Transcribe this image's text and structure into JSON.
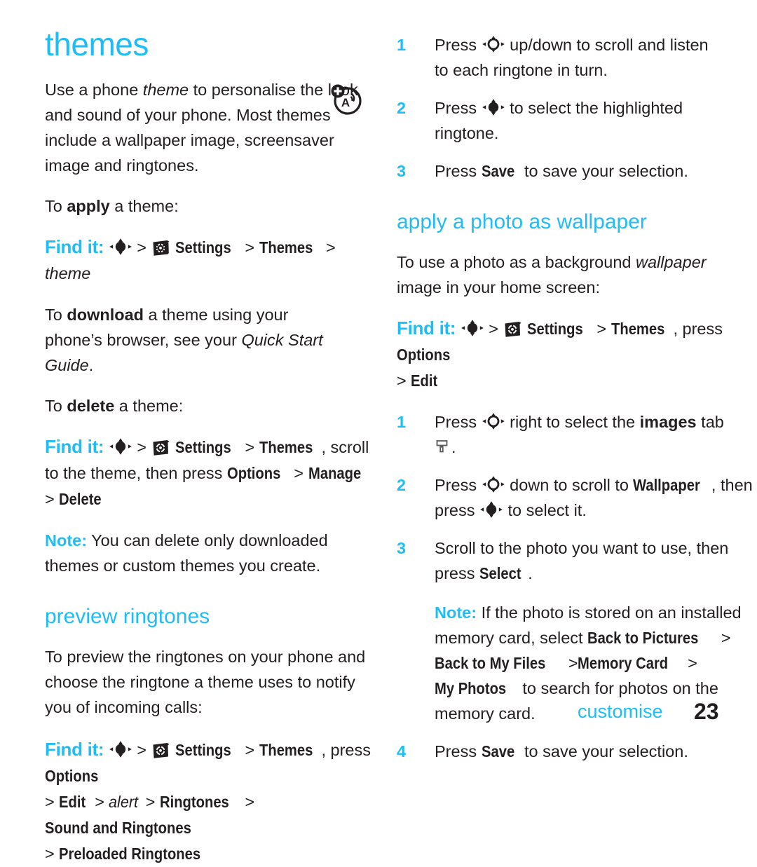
{
  "page": {
    "number": "23",
    "chapter_label": "customise",
    "accent_color": "#20bdf4",
    "text_color": "#231f20"
  },
  "left_column": {
    "title": "themes",
    "chapter_icon": "themes-personalise-icon",
    "intro": {
      "t1": "Use a phone ",
      "t2": "theme",
      "t3": " to personalise the look and sound of your phone. Most themes include a wallpaper image, screensaver image and ringtones."
    },
    "apply_lead": {
      "t1": "To ",
      "t2": "apply",
      "t3": " a theme:"
    },
    "findit_apply": {
      "label": "Find it:",
      "icon1": "navigation-key-select-icon",
      "sep1": ">",
      "icon2": "settings-gear-icon",
      "w1": "Settings",
      "sep2": ">",
      "w2": "Themes",
      "sep3": ">",
      "w3": "theme"
    },
    "download_para": {
      "t1": "To ",
      "t2": "download",
      "t3": " a theme using your phone’s browser, see your ",
      "t4": "Quick Start Guide",
      "t5": "."
    },
    "delete_lead": {
      "t1": "To ",
      "t2": "delete",
      "t3": " a theme:"
    },
    "findit_delete": {
      "label": "Find it:",
      "icon1": "navigation-key-select-icon",
      "sep1": ">",
      "icon2": "settings-gear-icon",
      "w1": "Settings",
      "sep2": ">",
      "w2": "Themes",
      "t_mid": ", scroll to the theme, then press ",
      "w3": "Options",
      "sep3": ">",
      "w4": "Manage",
      "sep4": ">",
      "w5": "Delete"
    },
    "note_delete": {
      "label": "Note:",
      "text": " You can delete only downloaded themes or custom themes you create."
    },
    "preview_title": "preview ringtones",
    "preview_para": "To preview the ringtones on your phone and choose the ringtone a theme uses to notify you of incoming calls:",
    "findit_preview": {
      "label": "Find it:",
      "icon1": "navigation-key-select-icon",
      "sep1": ">",
      "icon2": "settings-gear-icon",
      "w1": "Settings",
      "sep2": ">",
      "w2": "Themes",
      "t_mid": ", press ",
      "w3": "Options",
      "line2_sep1": ">",
      "w4": "Edit",
      "line2_sep2": ">",
      "w5": "alert",
      "line2_sep3": ">",
      "w6": "Ringtones",
      "line2_sep4": ">",
      "w7": "Sound and Ringtones",
      "line3_sep": ">",
      "w8": "Preloaded Ringtones"
    }
  },
  "right_column": {
    "steps_preview": [
      {
        "num": "1",
        "t1": "Press ",
        "icon": "navigation-key-scroll-icon",
        "t2": " up/down to scroll and listen to each ringtone in turn."
      },
      {
        "num": "2",
        "t1": "Press ",
        "icon": "navigation-key-select-icon",
        "t2": " to select the highlighted ringtone."
      },
      {
        "num": "3",
        "t1": "Press ",
        "w": "Save",
        "t2": " to save your selection."
      }
    ],
    "wallpaper_title": "apply a photo as wallpaper",
    "wallpaper_para": {
      "t1": "To use a photo as a background ",
      "t2": "wallpaper",
      "t3": " image in your home screen:"
    },
    "findit_wallpaper": {
      "label": "Find it:",
      "icon1": "navigation-key-select-icon",
      "sep1": ">",
      "icon2": "settings-gear-icon",
      "w1": "Settings",
      "sep2": ">",
      "w2": "Themes",
      "t_mid": ", press ",
      "w3": "Options",
      "line2_sep": ">",
      "w4": "Edit"
    },
    "steps_wallpaper": [
      {
        "num": "1",
        "t1": "Press ",
        "icon": "navigation-key-scroll-icon",
        "t2": " right to select the ",
        "b1": "images",
        "t3": " tab ",
        "icon2": "paint-roller-images-tab-icon",
        "t4": "."
      },
      {
        "num": "2",
        "t1": "Press ",
        "icon": "navigation-key-scroll-icon",
        "t2": " down to scroll to ",
        "w1": "Wallpaper",
        "t3": ", then press ",
        "icon2": "navigation-key-select-icon",
        "t4": " to select it."
      },
      {
        "num": "3",
        "t1": "Scroll to the photo you want to use, then press ",
        "w1": "Select",
        "t2": "."
      }
    ],
    "note_memory": {
      "label": "Note:",
      "t1": " If the photo is stored on an installed memory card, select ",
      "w1": "Back to Pictures",
      "sep1": ">",
      "w2": "Back to My Files",
      "sep2": ">",
      "w3": "Memory Card",
      "sep3": ">",
      "w4": "My Photos",
      "t2": " to search for photos on the memory card."
    },
    "step_save": {
      "num": "4",
      "t1": "Press ",
      "w": "Save",
      "t2": " to save your selection."
    }
  }
}
